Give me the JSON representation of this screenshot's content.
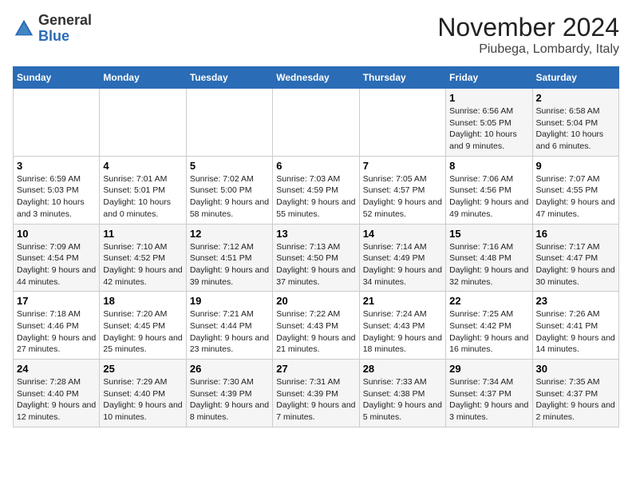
{
  "header": {
    "logo_general": "General",
    "logo_blue": "Blue",
    "month": "November 2024",
    "location": "Piubega, Lombardy, Italy"
  },
  "days_of_week": [
    "Sunday",
    "Monday",
    "Tuesday",
    "Wednesday",
    "Thursday",
    "Friday",
    "Saturday"
  ],
  "weeks": [
    [
      {
        "day": "",
        "info": ""
      },
      {
        "day": "",
        "info": ""
      },
      {
        "day": "",
        "info": ""
      },
      {
        "day": "",
        "info": ""
      },
      {
        "day": "",
        "info": ""
      },
      {
        "day": "1",
        "info": "Sunrise: 6:56 AM\nSunset: 5:05 PM\nDaylight: 10 hours and 9 minutes."
      },
      {
        "day": "2",
        "info": "Sunrise: 6:58 AM\nSunset: 5:04 PM\nDaylight: 10 hours and 6 minutes."
      }
    ],
    [
      {
        "day": "3",
        "info": "Sunrise: 6:59 AM\nSunset: 5:03 PM\nDaylight: 10 hours and 3 minutes."
      },
      {
        "day": "4",
        "info": "Sunrise: 7:01 AM\nSunset: 5:01 PM\nDaylight: 10 hours and 0 minutes."
      },
      {
        "day": "5",
        "info": "Sunrise: 7:02 AM\nSunset: 5:00 PM\nDaylight: 9 hours and 58 minutes."
      },
      {
        "day": "6",
        "info": "Sunrise: 7:03 AM\nSunset: 4:59 PM\nDaylight: 9 hours and 55 minutes."
      },
      {
        "day": "7",
        "info": "Sunrise: 7:05 AM\nSunset: 4:57 PM\nDaylight: 9 hours and 52 minutes."
      },
      {
        "day": "8",
        "info": "Sunrise: 7:06 AM\nSunset: 4:56 PM\nDaylight: 9 hours and 49 minutes."
      },
      {
        "day": "9",
        "info": "Sunrise: 7:07 AM\nSunset: 4:55 PM\nDaylight: 9 hours and 47 minutes."
      }
    ],
    [
      {
        "day": "10",
        "info": "Sunrise: 7:09 AM\nSunset: 4:54 PM\nDaylight: 9 hours and 44 minutes."
      },
      {
        "day": "11",
        "info": "Sunrise: 7:10 AM\nSunset: 4:52 PM\nDaylight: 9 hours and 42 minutes."
      },
      {
        "day": "12",
        "info": "Sunrise: 7:12 AM\nSunset: 4:51 PM\nDaylight: 9 hours and 39 minutes."
      },
      {
        "day": "13",
        "info": "Sunrise: 7:13 AM\nSunset: 4:50 PM\nDaylight: 9 hours and 37 minutes."
      },
      {
        "day": "14",
        "info": "Sunrise: 7:14 AM\nSunset: 4:49 PM\nDaylight: 9 hours and 34 minutes."
      },
      {
        "day": "15",
        "info": "Sunrise: 7:16 AM\nSunset: 4:48 PM\nDaylight: 9 hours and 32 minutes."
      },
      {
        "day": "16",
        "info": "Sunrise: 7:17 AM\nSunset: 4:47 PM\nDaylight: 9 hours and 30 minutes."
      }
    ],
    [
      {
        "day": "17",
        "info": "Sunrise: 7:18 AM\nSunset: 4:46 PM\nDaylight: 9 hours and 27 minutes."
      },
      {
        "day": "18",
        "info": "Sunrise: 7:20 AM\nSunset: 4:45 PM\nDaylight: 9 hours and 25 minutes."
      },
      {
        "day": "19",
        "info": "Sunrise: 7:21 AM\nSunset: 4:44 PM\nDaylight: 9 hours and 23 minutes."
      },
      {
        "day": "20",
        "info": "Sunrise: 7:22 AM\nSunset: 4:43 PM\nDaylight: 9 hours and 21 minutes."
      },
      {
        "day": "21",
        "info": "Sunrise: 7:24 AM\nSunset: 4:43 PM\nDaylight: 9 hours and 18 minutes."
      },
      {
        "day": "22",
        "info": "Sunrise: 7:25 AM\nSunset: 4:42 PM\nDaylight: 9 hours and 16 minutes."
      },
      {
        "day": "23",
        "info": "Sunrise: 7:26 AM\nSunset: 4:41 PM\nDaylight: 9 hours and 14 minutes."
      }
    ],
    [
      {
        "day": "24",
        "info": "Sunrise: 7:28 AM\nSunset: 4:40 PM\nDaylight: 9 hours and 12 minutes."
      },
      {
        "day": "25",
        "info": "Sunrise: 7:29 AM\nSunset: 4:40 PM\nDaylight: 9 hours and 10 minutes."
      },
      {
        "day": "26",
        "info": "Sunrise: 7:30 AM\nSunset: 4:39 PM\nDaylight: 9 hours and 8 minutes."
      },
      {
        "day": "27",
        "info": "Sunrise: 7:31 AM\nSunset: 4:39 PM\nDaylight: 9 hours and 7 minutes."
      },
      {
        "day": "28",
        "info": "Sunrise: 7:33 AM\nSunset: 4:38 PM\nDaylight: 9 hours and 5 minutes."
      },
      {
        "day": "29",
        "info": "Sunrise: 7:34 AM\nSunset: 4:37 PM\nDaylight: 9 hours and 3 minutes."
      },
      {
        "day": "30",
        "info": "Sunrise: 7:35 AM\nSunset: 4:37 PM\nDaylight: 9 hours and 2 minutes."
      }
    ]
  ]
}
